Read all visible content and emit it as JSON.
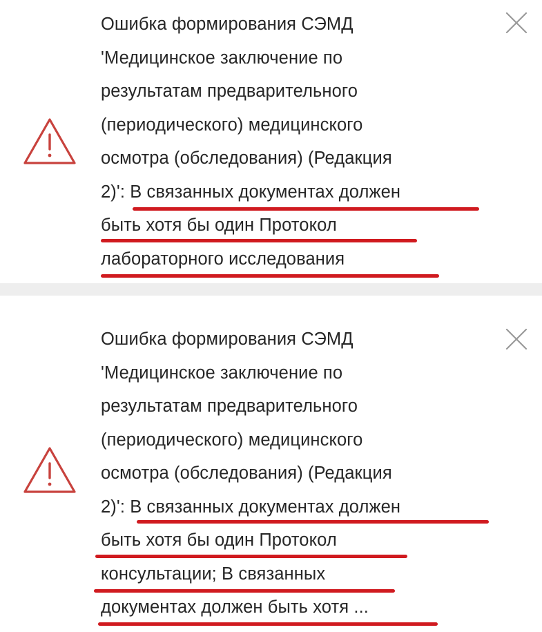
{
  "notifications": [
    {
      "lines": [
        "Ошибка формирования СЭМД",
        "'Медицинское заключение по",
        "результатам предварительного",
        "(периодического) медицинского",
        "осмотра (обследования) (Редакция",
        "2)': В связанных документах должен",
        "быть хотя бы один Протокол",
        "лабораторного исследования"
      ],
      "icon": "warning-triangle-icon",
      "close_icon": "close-icon"
    },
    {
      "lines": [
        "Ошибка формирования СЭМД",
        "'Медицинское заключение по",
        "результатам предварительного",
        "(периодического) медицинского",
        "осмотра (обследования) (Редакция",
        "2)': В связанных документах должен",
        "быть хотя бы один Протокол",
        "консультации; В связанных",
        "документах должен быть хотя ..."
      ],
      "icon": "warning-triangle-icon",
      "close_icon": "close-icon"
    }
  ],
  "colors": {
    "warning": "#c8423d",
    "underline": "#d01a1f",
    "close": "#9a9a9a",
    "text": "#262626"
  }
}
